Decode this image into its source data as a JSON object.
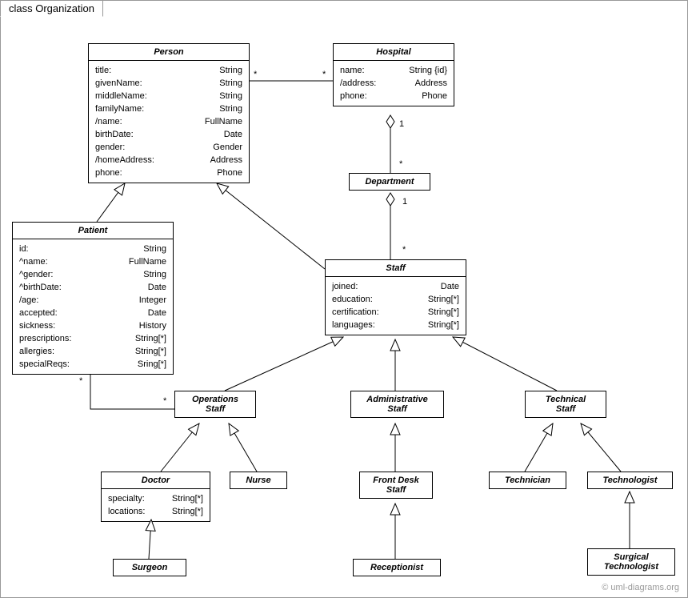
{
  "frame": {
    "title": "class Organization"
  },
  "credit": "© uml-diagrams.org",
  "classes": {
    "person": {
      "name": "Person",
      "attrs": [
        [
          "title:",
          "String"
        ],
        [
          "givenName:",
          "String"
        ],
        [
          "middleName:",
          "String"
        ],
        [
          "familyName:",
          "String"
        ],
        [
          "/name:",
          "FullName"
        ],
        [
          "birthDate:",
          "Date"
        ],
        [
          "gender:",
          "Gender"
        ],
        [
          "/homeAddress:",
          "Address"
        ],
        [
          "phone:",
          "Phone"
        ]
      ]
    },
    "hospital": {
      "name": "Hospital",
      "attrs": [
        [
          "name:",
          "String {id}"
        ],
        [
          "/address:",
          "Address"
        ],
        [
          "phone:",
          "Phone"
        ]
      ]
    },
    "department": {
      "name": "Department"
    },
    "patient": {
      "name": "Patient",
      "attrs": [
        [
          "id:",
          "String"
        ],
        [
          "^name:",
          "FullName"
        ],
        [
          "^gender:",
          "String"
        ],
        [
          "^birthDate:",
          "Date"
        ],
        [
          "/age:",
          "Integer"
        ],
        [
          "accepted:",
          "Date"
        ],
        [
          "sickness:",
          "History"
        ],
        [
          "prescriptions:",
          "String[*]"
        ],
        [
          "allergies:",
          "String[*]"
        ],
        [
          "specialReqs:",
          "Sring[*]"
        ]
      ]
    },
    "staff": {
      "name": "Staff",
      "attrs": [
        [
          "joined:",
          "Date"
        ],
        [
          "education:",
          "String[*]"
        ],
        [
          "certification:",
          "String[*]"
        ],
        [
          "languages:",
          "String[*]"
        ]
      ]
    },
    "opsStaff": {
      "name": "Operations Staff",
      "lines": [
        "Operations",
        "Staff"
      ]
    },
    "adminStaff": {
      "name": "Administrative Staff",
      "lines": [
        "Administrative",
        "Staff"
      ]
    },
    "techStaff": {
      "name": "Technical Staff",
      "lines": [
        "Technical",
        "Staff"
      ]
    },
    "doctor": {
      "name": "Doctor",
      "attrs": [
        [
          "specialty:",
          "String[*]"
        ],
        [
          "locations:",
          "String[*]"
        ]
      ]
    },
    "nurse": {
      "name": "Nurse"
    },
    "frontDesk": {
      "name": "Front Desk Staff",
      "lines": [
        "Front Desk",
        "Staff"
      ]
    },
    "receptionist": {
      "name": "Receptionist"
    },
    "technician": {
      "name": "Technician"
    },
    "technologist": {
      "name": "Technologist"
    },
    "surgTech": {
      "name": "Surgical Technologist",
      "lines": [
        "Surgical",
        "Technologist"
      ]
    },
    "surgeon": {
      "name": "Surgeon"
    }
  },
  "mults": {
    "person_hosp_left": "*",
    "person_hosp_right": "*",
    "hosp_dept_top": "1",
    "hosp_dept_bottom": "*",
    "dept_staff_top": "1",
    "dept_staff_bottom": "*",
    "patient_ops_top": "*",
    "patient_ops_bottom": "*"
  }
}
